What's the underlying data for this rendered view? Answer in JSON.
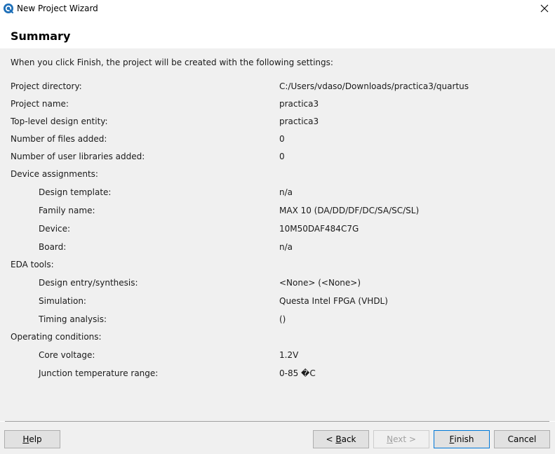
{
  "window": {
    "title": "New Project Wizard"
  },
  "header": {
    "title": "Summary"
  },
  "intro": "When you click Finish, the project will be created with the following settings:",
  "settings": [
    {
      "label": "Project directory:",
      "value": "C:/Users/vdaso/Downloads/practica3/quartus",
      "indent": false
    },
    {
      "label": "Project name:",
      "value": "practica3",
      "indent": false
    },
    {
      "label": "Top-level design entity:",
      "value": "practica3",
      "indent": false
    },
    {
      "label": "Number of files added:",
      "value": "0",
      "indent": false
    },
    {
      "label": "Number of user libraries added:",
      "value": "0",
      "indent": false
    },
    {
      "label": "Device assignments:",
      "value": "",
      "indent": false
    },
    {
      "label": "Design template:",
      "value": "n/a",
      "indent": true
    },
    {
      "label": "Family name:",
      "value": "MAX 10 (DA/DD/DF/DC/SA/SC/SL)",
      "indent": true
    },
    {
      "label": "Device:",
      "value": "10M50DAF484C7G",
      "indent": true
    },
    {
      "label": "Board:",
      "value": "n/a",
      "indent": true
    },
    {
      "label": "EDA tools:",
      "value": "",
      "indent": false
    },
    {
      "label": "Design entry/synthesis:",
      "value": "<None> (<None>)",
      "indent": true
    },
    {
      "label": "Simulation:",
      "value": "Questa Intel FPGA (VHDL)",
      "indent": true
    },
    {
      "label": "Timing analysis:",
      "value": " ()",
      "indent": true
    },
    {
      "label": "Operating conditions:",
      "value": "",
      "indent": false
    },
    {
      "label": "Core voltage:",
      "value": "1.2V",
      "indent": true
    },
    {
      "label": "Junction temperature range:",
      "value": "0-85 �C",
      "indent": true
    }
  ],
  "buttons": {
    "help": {
      "pre": "",
      "accel": "H",
      "post": "elp"
    },
    "back": {
      "pre": "< ",
      "accel": "B",
      "post": "ack"
    },
    "next": {
      "pre": "",
      "accel": "N",
      "post": "ext >"
    },
    "finish": {
      "pre": "",
      "accel": "F",
      "post": "inish"
    },
    "cancel": {
      "pre": "Cancel",
      "accel": "",
      "post": ""
    }
  },
  "colors": {
    "content_bg": "#f0f0f0",
    "accent": "#0078d7"
  }
}
